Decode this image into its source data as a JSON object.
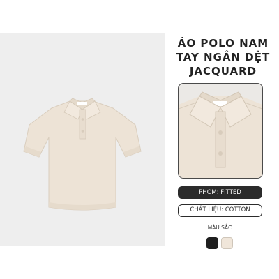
{
  "product": {
    "title_lines": [
      "ÁO POLO NAM",
      "TAY NGẮN DỆT",
      "JACQUARD"
    ],
    "fit_label": "PHOM: FITTED",
    "material_label": "CHẤT LIỆU: COTTON",
    "color_section_label": "MÀU SẮC",
    "colors": [
      {
        "name": "black",
        "hex": "#1f1f1f"
      },
      {
        "name": "cream",
        "hex": "#f0e6da"
      }
    ],
    "shirt_color": "#ede3d6"
  }
}
